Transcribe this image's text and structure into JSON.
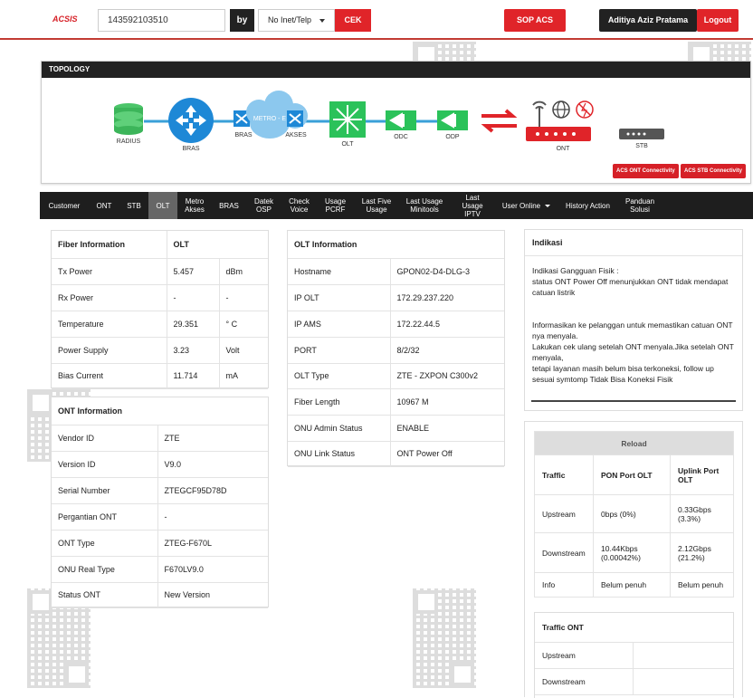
{
  "header": {
    "logo": "ACSIS",
    "search_value": "143592103510",
    "by_label": "by",
    "search_type": "No Inet/Telp",
    "cek_label": "CEK",
    "sop_label": "SOP ACS",
    "user_name": "Aditiya Aziz Pratama",
    "logout_label": "Logout"
  },
  "topology": {
    "title": "TOPOLOGY",
    "nodes": {
      "radius": "RADIUS",
      "bras": "BRAS",
      "bras2": "BRAS",
      "metro": "METRO - E",
      "akses": "AKSES",
      "olt": "OLT",
      "odc": "ODC",
      "odp": "ODP",
      "ont": "ONT",
      "stb": "STB"
    },
    "ont_connectivity": "ACS ONT Connectivity",
    "stb_connectivity": "ACS STB Connectivity"
  },
  "nav": [
    {
      "label": "Customer"
    },
    {
      "label": "ONT"
    },
    {
      "label": "STB"
    },
    {
      "label": "OLT",
      "active": true
    },
    {
      "label": "Metro Akses"
    },
    {
      "label": "BRAS"
    },
    {
      "label": "Datek OSP"
    },
    {
      "label": "Check Voice"
    },
    {
      "label": "Usage PCRF"
    },
    {
      "label": "Last Five Usage"
    },
    {
      "label": "Last Usage Minitools"
    },
    {
      "label": "Last Usage IPTV"
    },
    {
      "label": "User Online",
      "dropdown": true
    },
    {
      "label": "History Action"
    },
    {
      "label": "Panduan Solusi"
    }
  ],
  "fiber": {
    "header": [
      "Fiber Information",
      "OLT"
    ],
    "rows": [
      [
        "Tx Power",
        "5.457",
        "dBm"
      ],
      [
        "Rx Power",
        "-",
        "-"
      ],
      [
        "Temperature",
        "29.351",
        "° C"
      ],
      [
        "Power Supply",
        "3.23",
        "Volt"
      ],
      [
        "Bias Current",
        "11.714",
        "mA"
      ]
    ]
  },
  "ont": {
    "header": "ONT Information",
    "rows": [
      [
        "Vendor ID",
        "ZTE"
      ],
      [
        "Version ID",
        "V9.0"
      ],
      [
        "Serial Number",
        "ZTEGCF95D78D"
      ],
      [
        "Pergantian ONT",
        "-"
      ],
      [
        "ONT Type",
        "ZTEG-F670L"
      ],
      [
        "ONU Real Type",
        "F670LV9.0"
      ],
      [
        "Status ONT",
        "New Version"
      ]
    ]
  },
  "olt": {
    "header": "OLT Information",
    "rows": [
      [
        "Hostname",
        "GPON02-D4-DLG-3"
      ],
      [
        "IP OLT",
        "172.29.237.220"
      ],
      [
        "IP AMS",
        "172.22.44.5"
      ],
      [
        "PORT",
        "8/2/32"
      ],
      [
        "OLT Type",
        "ZTE - ZXPON C300v2"
      ],
      [
        "Fiber Length",
        "10967 M"
      ],
      [
        "ONU Admin Status",
        "ENABLE"
      ],
      [
        "ONU Link Status",
        "ONT Power Off"
      ]
    ]
  },
  "indikasi": {
    "title": "Indikasi",
    "lines": [
      "Indikasi Gangguan Fisik :",
      "status ONT Power Off menunjukkan ONT tidak mendapat catuan listrik",
      "",
      "",
      "Informasikan ke pelanggan untuk memastikan catuan ONT nya menyala.",
      "Lakukan cek ulang setelah ONT menyala.Jika setelah ONT menyala,",
      "tetapi layanan masih belum bisa terkoneksi, follow up sesuai symtomp Tidak Bisa Koneksi Fisik"
    ]
  },
  "traffic": {
    "reload_label": "Reload",
    "header": [
      "Traffic",
      "PON Port OLT",
      "Uplink Port OLT"
    ],
    "rows": [
      [
        "Upstream",
        "0bps (0%)",
        "0.33Gbps (3.3%)"
      ],
      [
        "Downstream",
        "10.44Kbps (0.00042%)",
        "2.12Gbps (21.2%)"
      ],
      [
        "Info",
        "Belum penuh",
        "Belum penuh"
      ]
    ],
    "ont_title": "Traffic ONT",
    "ont_rows": [
      [
        "Upstream",
        ""
      ],
      [
        "Downstream",
        ""
      ]
    ]
  }
}
